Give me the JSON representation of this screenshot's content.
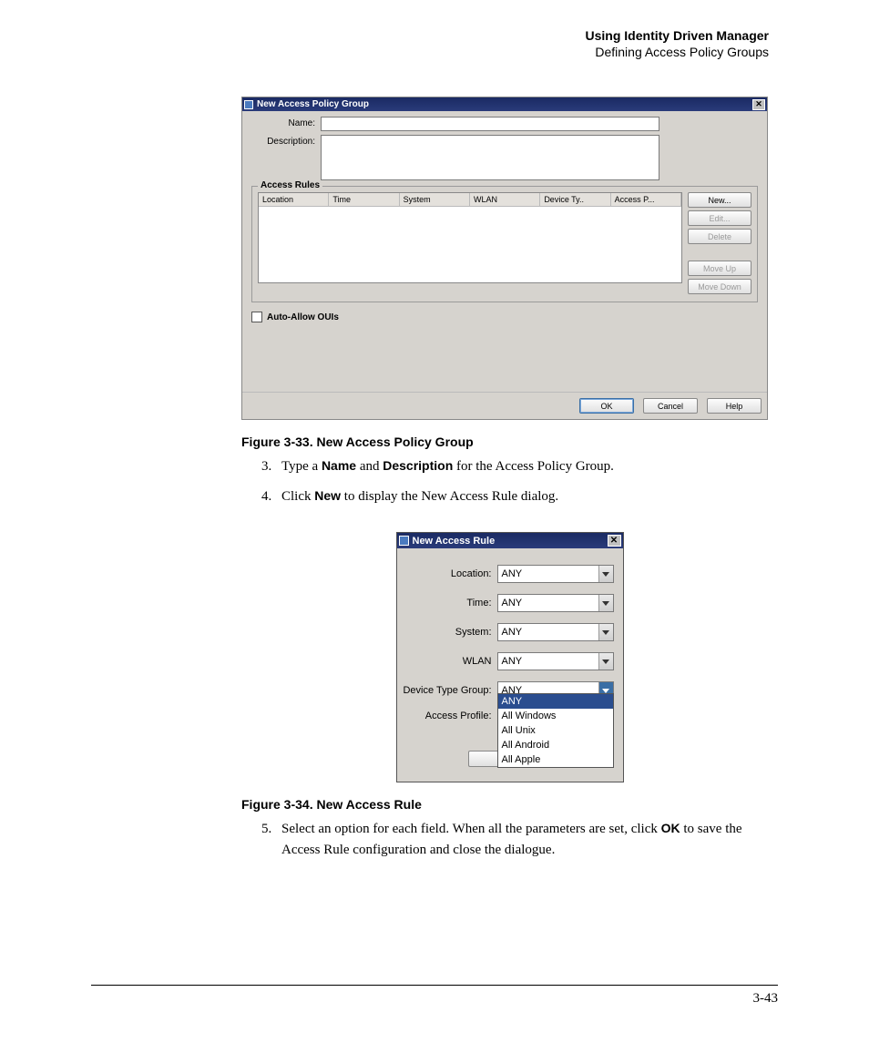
{
  "header": {
    "chapter": "Using Identity Driven Manager",
    "section": "Defining Access Policy Groups"
  },
  "dialog1": {
    "title": "New Access Policy Group",
    "close": "✕",
    "labels": {
      "name": "Name:",
      "description": "Description:"
    },
    "fieldset_title": "Access Rules",
    "columns": [
      "Location",
      "Time",
      "System",
      "WLAN",
      "Device Ty..",
      "Access P..."
    ],
    "buttons": {
      "new": "New...",
      "edit": "Edit...",
      "delete": "Delete",
      "up": "Move Up",
      "down": "Move Down"
    },
    "auto_allow": "Auto-Allow OUIs",
    "footer": {
      "ok": "OK",
      "cancel": "Cancel",
      "help": "Help"
    }
  },
  "caption1": "Figure 3-33. New Access Policy Group",
  "step3": {
    "num": "3.",
    "pre": "Type a ",
    "b1": "Name",
    "mid": " and ",
    "b2": "Description",
    "post": " for the Access Policy Group."
  },
  "step4": {
    "num": "4.",
    "pre": "Click ",
    "b1": "New",
    "post": " to display the New Access Rule dialog."
  },
  "dialog2": {
    "title": "New Access Rule",
    "close": "✕",
    "fields": {
      "location": {
        "label": "Location:",
        "value": "ANY"
      },
      "time": {
        "label": "Time:",
        "value": "ANY"
      },
      "system": {
        "label": "System:",
        "value": "ANY"
      },
      "wlan": {
        "label": "WLAN",
        "value": "ANY"
      },
      "device": {
        "label": "Device Type Group:",
        "value": "ANY"
      },
      "profile": {
        "label": "Access Profile:"
      }
    },
    "options": [
      "ANY",
      "All Windows",
      "All Unix",
      "All Android",
      "All Apple"
    ]
  },
  "caption2": "Figure 3-34. New Access Rule",
  "step5": {
    "num": "5.",
    "pre": "Select an option for each field. When all the parameters are set, click ",
    "b1": "OK",
    "post": " to save the Access Rule configuration and close the dialogue."
  },
  "pagenum": "3-43"
}
